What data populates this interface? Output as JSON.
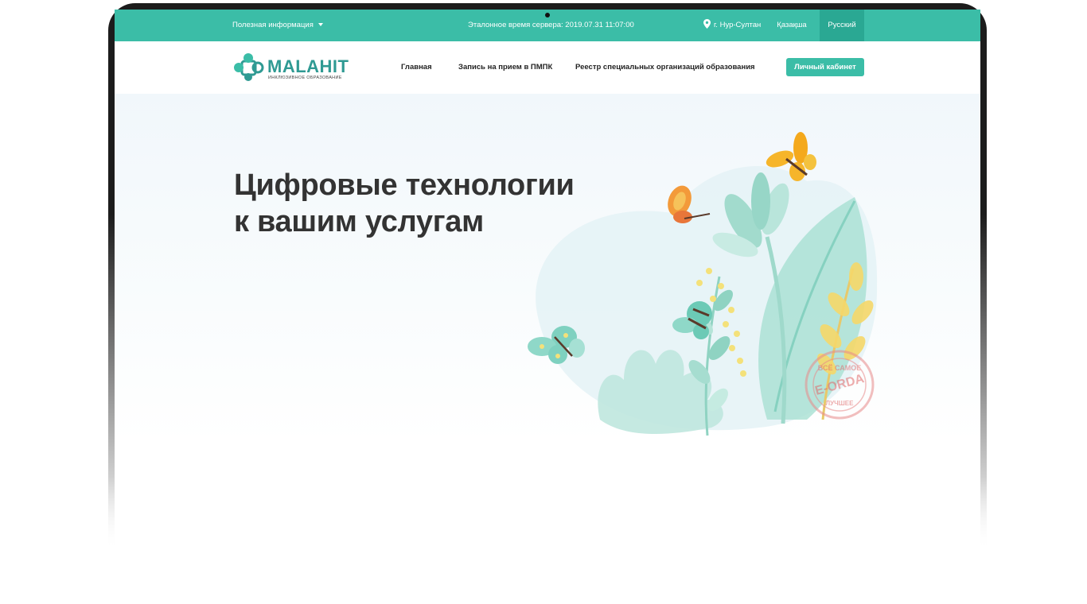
{
  "topbar": {
    "info_menu_label": "Полезная информация",
    "server_time_label": "Эталонное время сервера: 2019.07.31 11:07:00",
    "city_label": "г. Нур-Султан",
    "lang_kz_label": "Қазақша",
    "lang_ru_label": "Русский"
  },
  "logo": {
    "brand": "MALAHIT",
    "tagline": "ИНКЛЮЗИВНОЕ ОБРАЗОВАНИЕ"
  },
  "nav": {
    "items": [
      {
        "label": "Главная"
      },
      {
        "label": "Запись на прием в ПМПК"
      },
      {
        "label": "Реестр специальных организаций образования"
      }
    ],
    "cabinet_label": "Личный кабинет"
  },
  "hero": {
    "title_line1": "Цифровые технологии",
    "title_line2": "к вашим услугам"
  },
  "stamp": {
    "top_text": "ВСЁ САМОЕ",
    "main_text": "E-ORDA",
    "bottom_text": "ЛУЧШЕЕ"
  },
  "colors": {
    "accent": "#3bbda7",
    "accent_dark": "#2aa893",
    "brand_text": "#2f9a93",
    "title_text": "#333333"
  },
  "icons": [
    "caret-down-icon",
    "map-pin-icon",
    "puzzle-logo-icon"
  ]
}
